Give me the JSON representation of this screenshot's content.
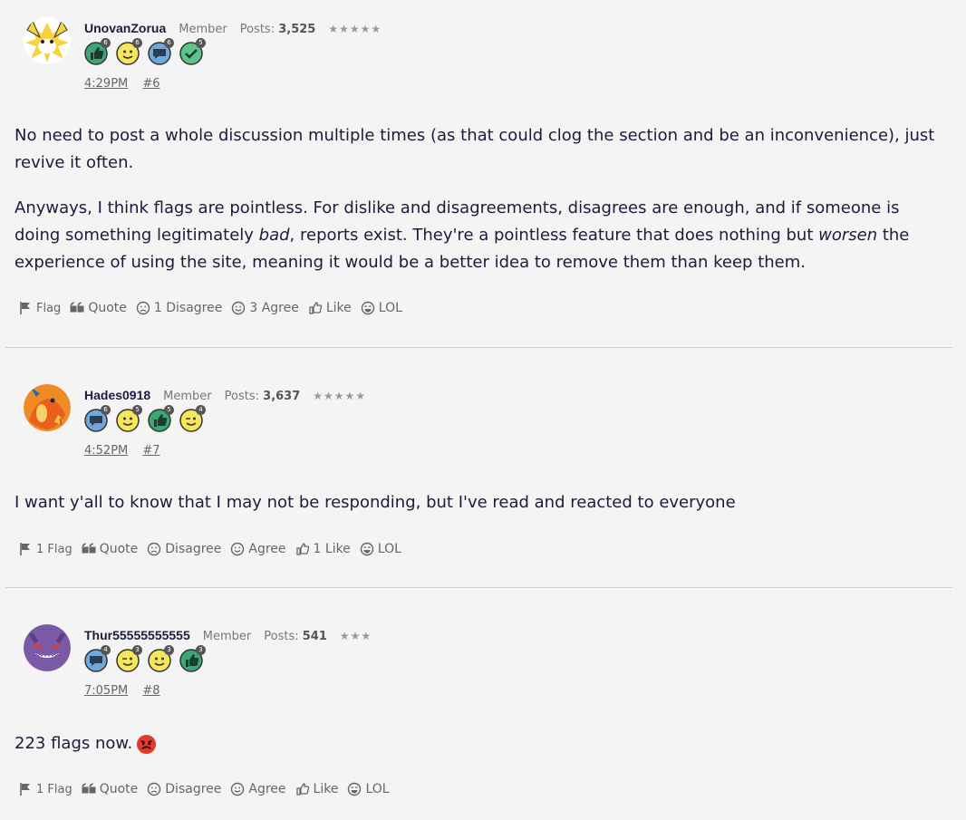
{
  "posts": [
    {
      "username": "UnovanZorua",
      "role": "Member",
      "posts_label": "Posts:",
      "posts_count": "3,525",
      "stars": "★★★★★",
      "badges": [
        {
          "icon": "like-icon",
          "count": "6",
          "color": "#3aa776"
        },
        {
          "icon": "agree-smile-icon",
          "count": "6",
          "color": "#f7e65b"
        },
        {
          "icon": "comment-icon",
          "count": "6",
          "color": "#6fa8dc"
        },
        {
          "icon": "checkmark-icon",
          "count": "5",
          "color": "#5bc489"
        }
      ],
      "time": "4:29PM",
      "number": "#6",
      "paragraphs": [
        [
          "No need to post a whole discussion multiple times (as that could clog the section and be an inconvenience), just revive it often."
        ],
        [
          "Anyways, I think flags are pointless. For dislike and disagreements, disagrees are enough, and if someone is doing something legitimately ",
          "bad",
          ", reports exist. They're a pointless feature that does nothing but ",
          "worsen",
          " the experience of using the site, meaning it would be a better idea to remove them than keep them."
        ]
      ],
      "actions": [
        "Flag",
        "Quote",
        "1 Disagree",
        "3 Agree",
        "Like",
        "LOL"
      ]
    },
    {
      "username": "Hades0918",
      "role": "Member",
      "posts_label": "Posts:",
      "posts_count": "3,637",
      "stars": "★★★★★",
      "badges": [
        {
          "icon": "comment-icon",
          "count": "6",
          "color": "#6fa8dc"
        },
        {
          "icon": "agree-smile-icon",
          "count": "5",
          "color": "#f7e65b"
        },
        {
          "icon": "like-icon",
          "count": "5",
          "color": "#3aa776"
        },
        {
          "icon": "wink-icon",
          "count": "4",
          "color": "#f7e65b"
        }
      ],
      "time": "4:52PM",
      "number": "#7",
      "paragraphs": [
        [
          "I want y'all to know that I may not be responding, but I've read and reacted to everyone"
        ]
      ],
      "actions": [
        "1 Flag",
        "Quote",
        "Disagree",
        "Agree",
        "1 Like",
        "LOL"
      ]
    },
    {
      "username": "Thur55555555555",
      "role": "Member",
      "posts_label": "Posts:",
      "posts_count": "541",
      "stars": "★★★",
      "badges": [
        {
          "icon": "comment-icon",
          "count": "4",
          "color": "#6fa8dc"
        },
        {
          "icon": "wink-icon",
          "count": "3",
          "color": "#f7e65b"
        },
        {
          "icon": "agree-smile-icon",
          "count": "3",
          "color": "#f7e65b"
        },
        {
          "icon": "like-icon",
          "count": "3",
          "color": "#3aa776"
        }
      ],
      "time": "7:05PM",
      "number": "#8",
      "paragraphs": [
        [
          "223 flags now."
        ]
      ],
      "actions": [
        "1 Flag",
        "Quote",
        "Disagree",
        "Agree",
        "Like",
        "LOL"
      ]
    }
  ],
  "colors": {
    "background": "#f4f4f4",
    "text": "#1e1a3c",
    "muted": "#666666",
    "divider": "#cfcfcf",
    "angry_emoji": "#e23b2e"
  },
  "icons": {
    "action_icons": [
      "flag-icon",
      "quote-icon",
      "frown-icon",
      "smile-icon",
      "thumbs-up-icon",
      "laugh-icon"
    ],
    "inline_emoji": "angry-face-icon"
  }
}
